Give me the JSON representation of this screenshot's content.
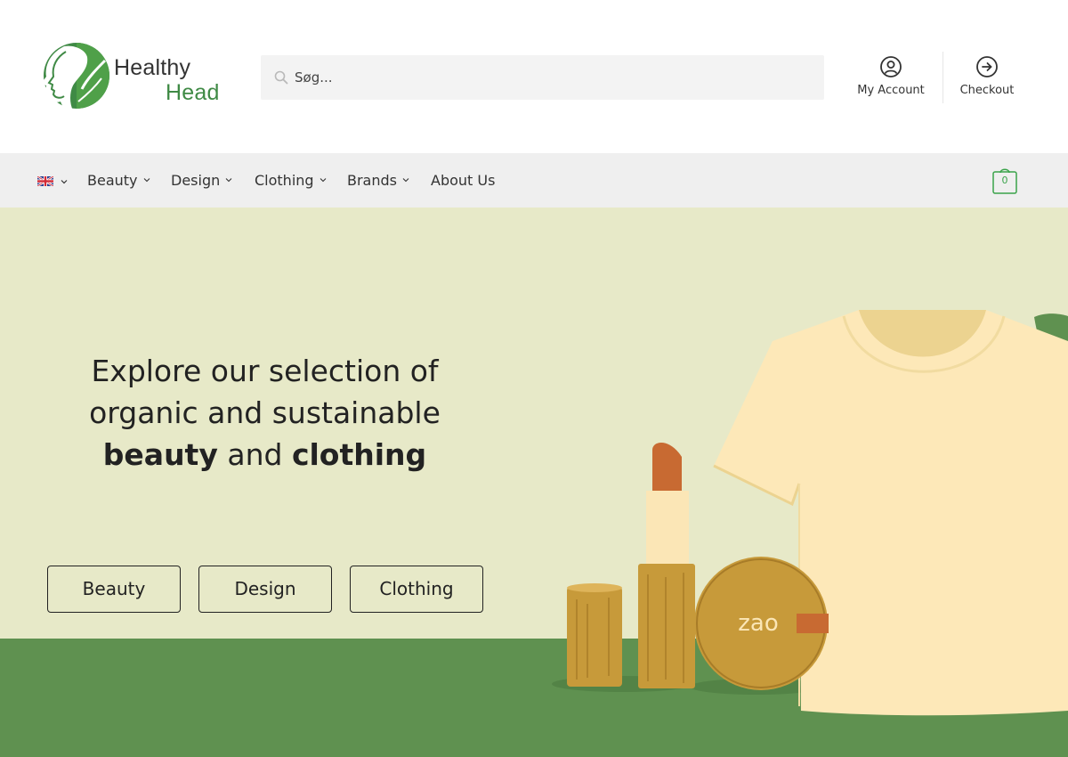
{
  "brand": {
    "name_line1": "Healthy",
    "name_line2": "Head",
    "colors": {
      "green": "#3f8a45",
      "green_light": "#62b05b"
    }
  },
  "search": {
    "placeholder": "Søg...",
    "value": ""
  },
  "header_links": {
    "account": {
      "label": "My Account",
      "icon": "user-circle-icon"
    },
    "checkout": {
      "label": "Checkout",
      "icon": "arrow-circle-right-icon"
    }
  },
  "nav": {
    "language": {
      "icon": "uk-flag-icon"
    },
    "items": [
      {
        "label": "Beauty",
        "has_dropdown": true
      },
      {
        "label": "Design",
        "has_dropdown": true
      },
      {
        "label": "Clothing",
        "has_dropdown": true
      },
      {
        "label": "Brands",
        "has_dropdown": true
      },
      {
        "label": "About Us",
        "has_dropdown": false
      }
    ],
    "cart": {
      "count": "0",
      "icon": "shopping-bag-icon"
    }
  },
  "hero": {
    "title_part1": "Explore our selection of organic and sustainable ",
    "title_bold1": "beauty",
    "title_part2": " and ",
    "title_bold2": "clothing",
    "buttons": [
      "Beauty",
      "Design",
      "Clothing"
    ],
    "product_brand_text": "zao",
    "colors": {
      "background": "#e7e9c8",
      "ground": "#5f9150"
    }
  }
}
